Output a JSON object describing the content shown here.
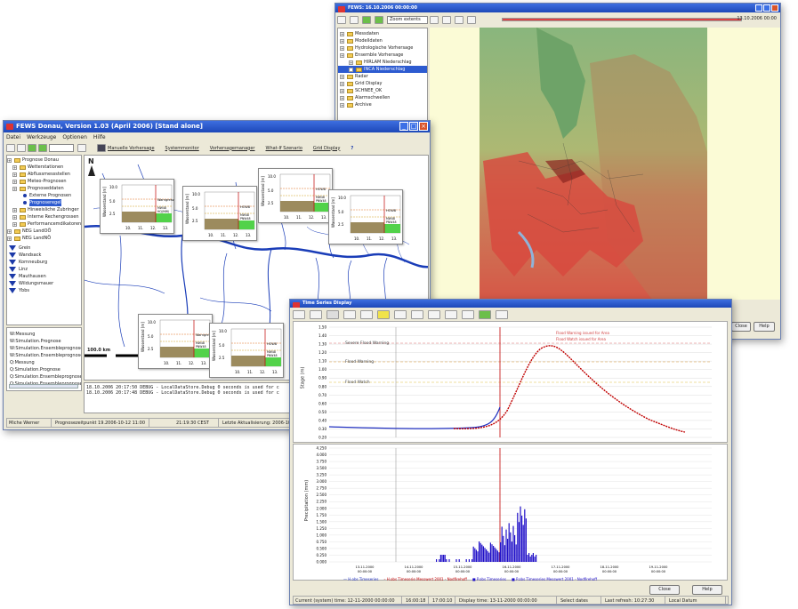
{
  "map_window": {
    "title": "FEWS: 16.10.2006 00:00:00",
    "dropdown": "Zoom extents",
    "time_label": "13.10.2006 00:00",
    "tree": [
      "Messdaten",
      "Modelldaten",
      "Hydrologische Vorhersage",
      "Ensemble Vorhersage",
      "HIRLAM Niederschlag",
      "INCA Niederschlag",
      "Radar",
      "Grid Display",
      "SCHNEE_OK",
      "Alarmschwellen",
      "Archive"
    ],
    "buttons": {
      "left": "Close",
      "right": "Help"
    }
  },
  "fews_window": {
    "title": "FEWS Donau, Version 1.03 (April 2006)  [Stand alone]",
    "menu": [
      "Datei",
      "Werkzeuge",
      "Optionen",
      "Hilfe"
    ],
    "toolbar": [
      "Manuelle Vorhersage",
      "Systemmonitor",
      "Vorhersagemanager",
      "What-If Szenario",
      "Grid Display",
      "?"
    ],
    "tree": [
      {
        "label": "Prognose Donau",
        "indent": 0,
        "type": "folder"
      },
      {
        "label": "Wetterstationen",
        "indent": 1,
        "type": "folder"
      },
      {
        "label": "Abflussmessstellen",
        "indent": 1,
        "type": "folder"
      },
      {
        "label": "Meteo-Prognosen",
        "indent": 1,
        "type": "folder"
      },
      {
        "label": "Prognoseddaten",
        "indent": 1,
        "type": "folder"
      },
      {
        "label": "Externe Prognosen",
        "indent": 2,
        "type": "node"
      },
      {
        "label": "Prognoseregel",
        "indent": 2,
        "type": "node",
        "selected": true
      },
      {
        "label": "Hinweisliche Zubringer",
        "indent": 1,
        "type": "folder"
      },
      {
        "label": "Interne Rechengrossen",
        "indent": 1,
        "type": "folder"
      },
      {
        "label": "Performancemdikatoren",
        "indent": 1,
        "type": "folder"
      },
      {
        "label": "NEG LandOÖ",
        "indent": 0,
        "type": "folder"
      },
      {
        "label": "NEG LandNÖ",
        "indent": 0,
        "type": "folder"
      }
    ],
    "stations": [
      "Grein",
      "Wandsack",
      "Kornneuburg",
      "Linz",
      "Mauthausen",
      "Wildungsmauer",
      "Ybbs"
    ],
    "list": [
      "W:Messung",
      "W:Simulation.Prognose",
      "W:Simulation.Ensembleprognose",
      "W:Simulation.Ensembleprognose",
      "Q:Messung",
      "Q:Simulation.Prognose",
      "Q:Simulation.Ensembleprognose",
      "Q:Simulation.Ensembleprognose"
    ],
    "scale": "100.0 km",
    "north": "N",
    "minicharts": [
      {
        "ylabel": "Wasserstand [m]",
        "ymax": "10.0",
        "ymid": "5.0",
        "ylow": "2.5",
        "x": [
          "10.",
          "11.",
          "12.",
          "13."
        ],
        "tag": "Warngrenz",
        "a": "MW48",
        "b": "HQ(MW)"
      },
      {
        "ylabel": "Wasserstand [m]",
        "ymax": "10.0",
        "ymid": "5.0",
        "ylow": "2.5",
        "x": [
          "10.",
          "11.",
          "12.",
          "13."
        ],
        "tag": "HOW8",
        "a": "MW48",
        "b": "PNW48"
      },
      {
        "ylabel": "Wasserstand [m]",
        "ymax": "10.0",
        "ymid": "5.0",
        "ylow": "2.5",
        "x": [
          "10.",
          "11.",
          "12.",
          "13."
        ],
        "tag": "HOW8",
        "a": "MW48",
        "b": "PNW48"
      },
      {
        "ylabel": "Wasserstand [m]",
        "ymax": "10.0",
        "ymid": "5.0",
        "ylow": "2.5",
        "x": [
          "10.",
          "11.",
          "12.",
          "13."
        ],
        "tag": "HOW8",
        "a": "MW48",
        "b": "PNW48"
      },
      {
        "ylabel": "Wasserstand [m]",
        "ymax": "10.0",
        "ymid": "5.0",
        "ylow": "2.5",
        "x": [
          "10.",
          "11.",
          "12.",
          "13."
        ],
        "tag": "Warngrenz",
        "a": "MW48",
        "b": "PNW48"
      },
      {
        "ylabel": "Wasserstand [m]",
        "ymax": "10.0",
        "ymid": "5.0",
        "ylow": "2.5",
        "x": [
          "10.",
          "11.",
          "12.",
          "13."
        ],
        "tag": "HOW8",
        "a": "MW48",
        "b": "PNW48"
      }
    ],
    "log": [
      "18.10.2006 20:17:50 DEBUG - LocalDataStore.Debug 0 seconds is used for c",
      "18.10.2006 20:17:48 DEBUG - LocalDataStore.Debug 0 seconds is used for c"
    ],
    "status": [
      "Miche Werner",
      "Prognosezeitpunkt 19.2006-10-12 11:00",
      "21:19:30 CEST",
      "Letzte Aktualisierung: 2006-10-12 11"
    ]
  },
  "ts_window": {
    "title": "Time Series Display",
    "upper_ylabel": "Stage (m)",
    "lower_ylabel": "Precipitation (mm)",
    "upper_ticks": [
      "1.50",
      "1.40",
      "1.30",
      "1.20",
      "1.10",
      "1.00",
      "0.90",
      "0.80",
      "0.70",
      "0.60",
      "0.50",
      "0.40",
      "0.30",
      "0.20"
    ],
    "lower_ticks": [
      "4.250",
      "4.000",
      "3.750",
      "3.500",
      "3.250",
      "3.000",
      "2.750",
      "2.500",
      "2.250",
      "2.000",
      "1.750",
      "1.500",
      "1.250",
      "1.000",
      "0.750",
      "0.500",
      "0.250",
      "0.000"
    ],
    "warnings": [
      "Severe Flood Warning",
      "Flood Warning",
      "Flood Watch"
    ],
    "annotations": [
      "Flood Warning issued for Area",
      "Flood Watch issued for Area"
    ],
    "x_ticks": [
      "13-11-2000\n00:00:00",
      "14-11-2000\n00:00:00",
      "15-11-2000\n00:00:00",
      "16-11-2000\n00:00:00",
      "17-11-2000\n00:00:00",
      "18-11-2000\n00:00:00",
      "19-11-2000\n00:00:00"
    ],
    "legend": [
      "H.obs Timeseries",
      "H.obs Timeserie Messwert 2001 - Nodfirehoff",
      "P.obs Timeseries",
      "P.obs Timeseries Messwert 2001 - Nodfirehoff"
    ],
    "buttons": {
      "close": "Close",
      "help": "Help"
    },
    "status": [
      "Current (system) time: 12-11-2000 00:00:00",
      "16:00:18",
      "17:00:10",
      "Display time: 13-11-2000 00:00:00",
      "Select dates",
      "Last refresh: 10:27:30",
      "Local Datum"
    ]
  },
  "colors": {
    "title_bar": "#2a5bd7",
    "river": "#1a3db8",
    "flood": "#d03030",
    "forecast": "#c00000",
    "observed": "#2030c0",
    "precip": "#2010c8"
  }
}
